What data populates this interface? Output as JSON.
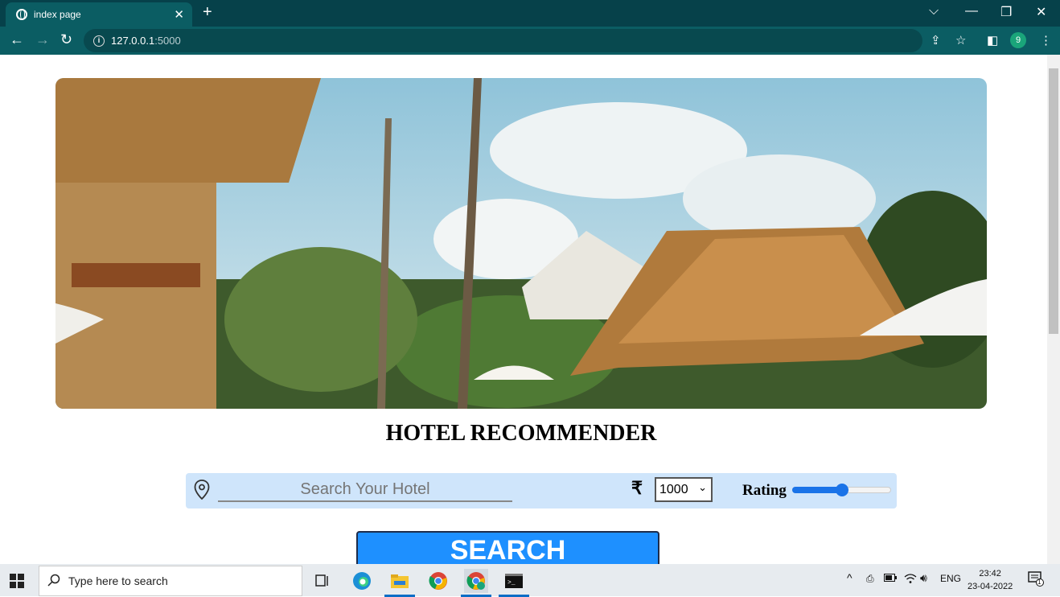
{
  "browser": {
    "tab_title": "index page",
    "url_host": "127.0.0.1",
    "url_port": ":5000",
    "profile_initial": "9"
  },
  "page": {
    "heading": "HOTEL RECOMMENDER",
    "search_placeholder": "Search Your Hotel",
    "currency_symbol": "₹",
    "price_selected": "1000",
    "rating_label": "Rating",
    "rating_value": 0.5,
    "search_button": "SEARCH"
  },
  "taskbar": {
    "search_placeholder": "Type here to search",
    "language": "ENG",
    "time": "23:42",
    "date": "23-04-2022",
    "notification_count": "1"
  },
  "colors": {
    "browser_frame": "#06414a",
    "search_bar_bg": "#cfe5fb",
    "search_button_bg": "#1e90ff"
  }
}
